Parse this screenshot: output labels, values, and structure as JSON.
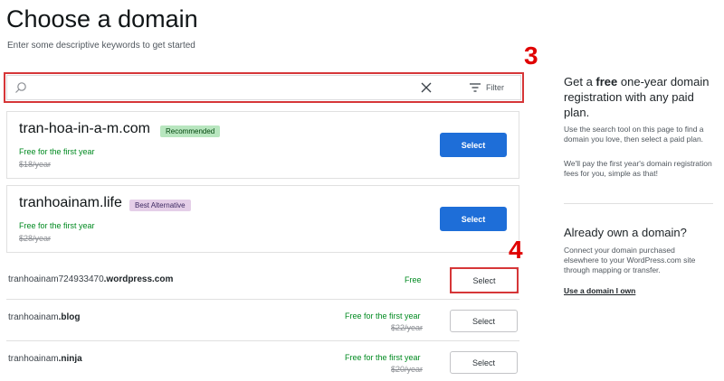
{
  "header": {
    "title": "Choose a domain",
    "subtitle": "Enter some descriptive keywords to get started"
  },
  "search": {
    "value": "",
    "placeholder": "",
    "filter_label": "Filter",
    "search_icon": "search-icon",
    "clear_icon": "close-icon",
    "filter_icon": "filter-icon"
  },
  "annotations": {
    "step3": "3",
    "step4": "4",
    "highlight_color": "#d63638",
    "number_color": "#e00000"
  },
  "featured": [
    {
      "domain": "tran-hoa-in-a-m.com",
      "badge": "Recommended",
      "badge_bg": "#b8e6bf",
      "badge_color": "#00450c",
      "offer": "Free for the first year",
      "price": "$18/year",
      "button": "Select"
    },
    {
      "domain": "tranhoainam.life",
      "badge": "Best Alternative",
      "badge_bg": "#e5cfe8",
      "badge_color": "#3c2861",
      "offer": "Free for the first year",
      "price": "$28/year",
      "button": "Select"
    }
  ],
  "results": [
    {
      "name": "tranhoainam724933470",
      "tld": ".wordpress.com",
      "offer": "Free",
      "price": "",
      "button": "Select"
    },
    {
      "name": "tranhoainam",
      "tld": ".blog",
      "offer": "Free for the first year",
      "price": "$22/year",
      "button": "Select"
    },
    {
      "name": "tranhoainam",
      "tld": ".ninja",
      "offer": "Free for the first year",
      "price": "$20/year",
      "button": "Select"
    }
  ],
  "sidebar": {
    "promo_pre": "Get a ",
    "promo_bold": "free",
    "promo_post": " one-year domain registration with any paid plan.",
    "promo_p1": "Use the search tool on this page to find a domain you love, then select a paid plan.",
    "promo_p2": "We'll pay the first year's domain registration fees for you, simple as that!",
    "own_heading": "Already own a domain?",
    "own_text": "Connect your domain purchased elsewhere to your WordPress.com site through mapping or transfer.",
    "own_link": "Use a domain I own"
  },
  "colors": {
    "primary": "#1e6ed8",
    "green": "#008a20"
  }
}
